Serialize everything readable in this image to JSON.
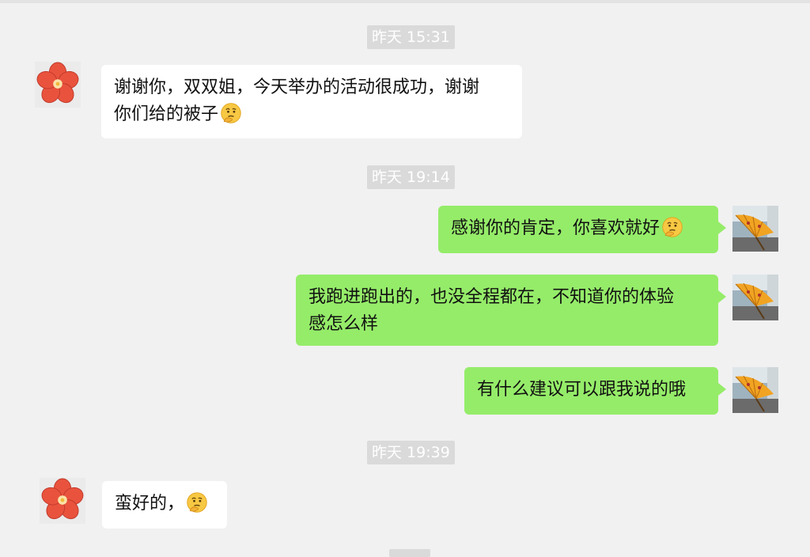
{
  "chat": {
    "timestamps": [
      "昨天 15:31",
      "昨天 19:14",
      "昨天 19:39"
    ],
    "messages": [
      {
        "side": "left",
        "avatar": "red-flower-avatar",
        "lines": [
          "谢谢你，双双姐，今天举办的活动很成功，谢谢",
          "你们给的被子"
        ],
        "emoji": "thinking-face-emoji"
      },
      {
        "side": "right",
        "avatar": "parasol-avatar",
        "lines": [
          "感谢你的肯定，你喜欢就好"
        ],
        "emoji": "thinking-face-emoji"
      },
      {
        "side": "right",
        "avatar": "parasol-avatar",
        "lines": [
          "我跑进跑出的，也没全程都在，不知道你的体验",
          "感怎么样"
        ]
      },
      {
        "side": "right",
        "avatar": "parasol-avatar",
        "lines": [
          "有什么建议可以跟我说的哦"
        ]
      },
      {
        "side": "left",
        "avatar": "red-flower-avatar",
        "lines": [
          "蛮好的，"
        ],
        "emoji": "thinking-face-emoji"
      }
    ]
  },
  "colors": {
    "background": "#f1f1f1",
    "left_bubble": "#ffffff",
    "right_bubble": "#95ec69",
    "timestamp_bg": "#dadada"
  }
}
